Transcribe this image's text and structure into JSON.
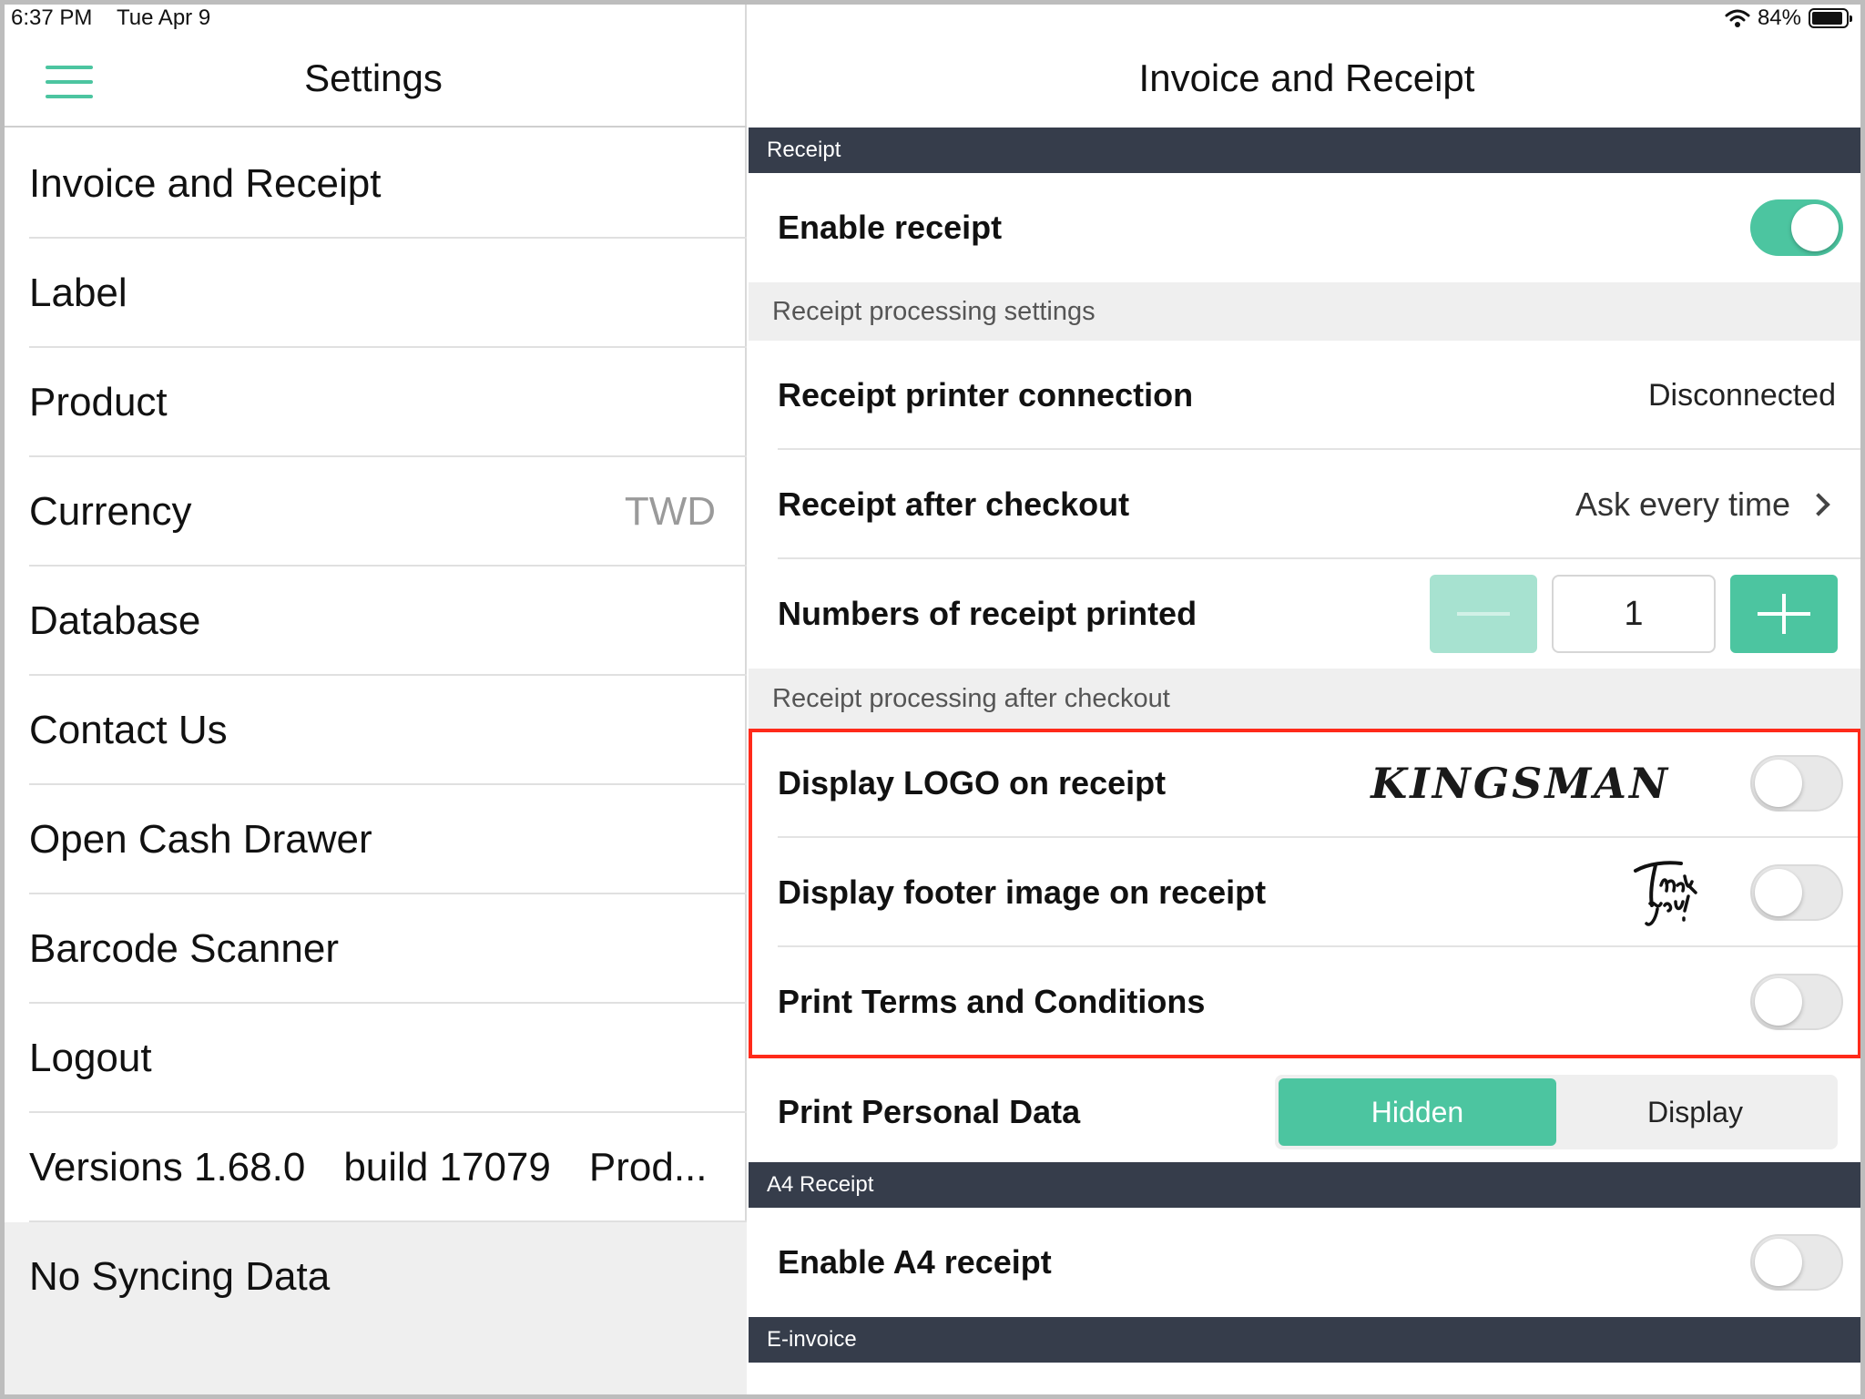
{
  "status_bar": {
    "time": "6:37 PM",
    "date": "Tue Apr 9",
    "battery": "84%"
  },
  "left": {
    "title": "Settings",
    "menu": [
      {
        "label": "Invoice and Receipt"
      },
      {
        "label": "Label"
      },
      {
        "label": "Product"
      },
      {
        "label": "Currency",
        "value": "TWD"
      },
      {
        "label": "Database"
      },
      {
        "label": "Contact Us"
      },
      {
        "label": "Open Cash Drawer"
      },
      {
        "label": "Barcode Scanner"
      },
      {
        "label": "Logout"
      }
    ],
    "version": {
      "version": "Versions 1.68.0",
      "build": "build 17079",
      "env": "Prod..."
    },
    "sync_status": "No Syncing Data"
  },
  "right": {
    "title": "Invoice and Receipt",
    "sections": {
      "receipt": "Receipt",
      "processing": "Receipt processing settings",
      "after_checkout": "Receipt processing after checkout",
      "a4": "A4 Receipt",
      "einvoice": "E-invoice"
    },
    "rows": {
      "enable_receipt": {
        "label": "Enable receipt",
        "on": true
      },
      "printer_connection": {
        "label": "Receipt printer connection",
        "value": "Disconnected"
      },
      "after_checkout": {
        "label": "Receipt after checkout",
        "value": "Ask every time"
      },
      "num_printed": {
        "label": "Numbers of receipt printed",
        "value": "1"
      },
      "display_logo": {
        "label": "Display LOGO on receipt",
        "logo_text": "KINGSMAN",
        "on": false
      },
      "display_footer": {
        "label": "Display footer image on receipt",
        "footer_text": "Thank you!",
        "on": false
      },
      "print_terms": {
        "label": "Print Terms and Conditions",
        "on": false
      },
      "personal_data": {
        "label": "Print Personal Data",
        "options": [
          "Hidden",
          "Display"
        ],
        "selected": "Hidden"
      },
      "enable_a4": {
        "label": "Enable A4 receipt",
        "on": false
      }
    }
  },
  "colors": {
    "accent": "#4cc5a0",
    "section_dark": "#363d4b",
    "highlight_box": "#ff2a1a"
  }
}
